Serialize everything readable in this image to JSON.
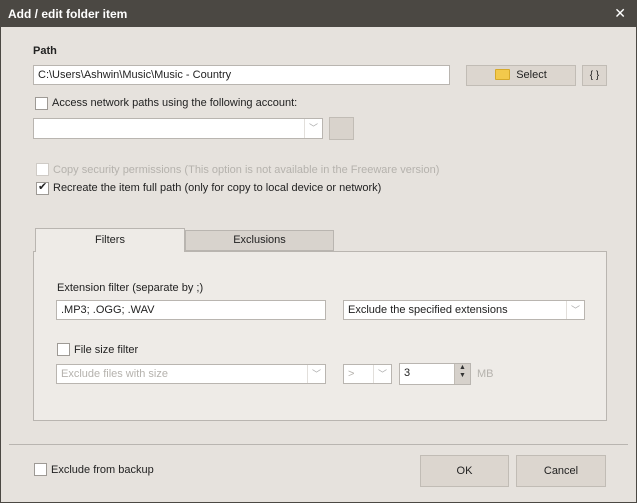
{
  "window": {
    "title": "Add / edit folder item",
    "close_icon": "close-icon"
  },
  "path": {
    "label": "Path",
    "value": "C:\\Users\\Ashwin\\Music\\Music - Country",
    "select_button": "Select",
    "select_icon": "folder-icon",
    "variables_button": "{ }"
  },
  "network": {
    "checkbox_label": "Access network paths using the following account:",
    "checked": false,
    "account_value": ""
  },
  "options": {
    "copy_security_label": "Copy security permissions (This option is not available in the Freeware version)",
    "copy_security_checked": false,
    "copy_security_enabled": false,
    "recreate_path_label": "Recreate the item full path (only for copy to local device or network)",
    "recreate_path_checked": true
  },
  "tabs": [
    {
      "label": "Filters",
      "active": true
    },
    {
      "label": "Exclusions",
      "active": false
    }
  ],
  "filters": {
    "extension_label": "Extension filter (separate by ;)",
    "extension_value": ".MP3; .OGG; .WAV",
    "extension_mode": "Exclude the specified extensions",
    "file_size_label": "File size filter",
    "file_size_checked": false,
    "size_mode": "Exclude files with size",
    "size_operator": ">",
    "size_value": "3",
    "size_unit": "MB"
  },
  "footer": {
    "exclude_label": "Exclude from backup",
    "exclude_checked": false,
    "ok_label": "OK",
    "cancel_label": "Cancel"
  }
}
